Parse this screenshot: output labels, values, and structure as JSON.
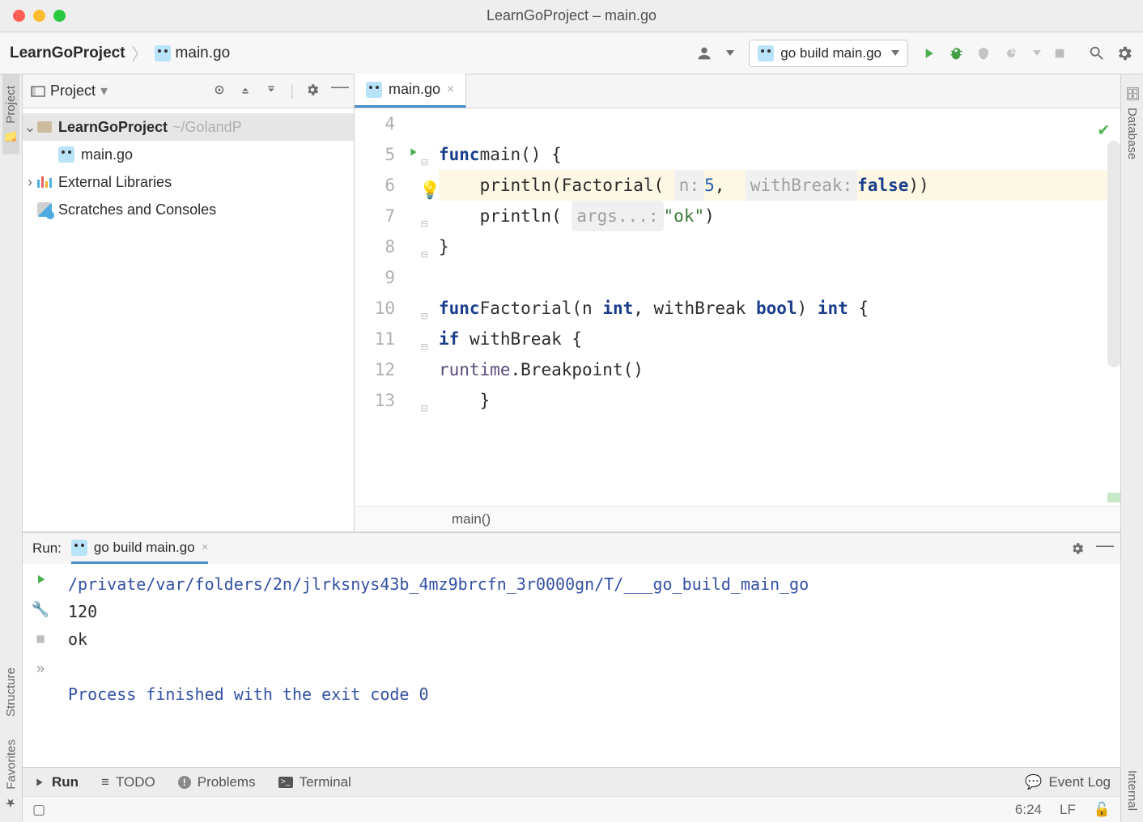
{
  "window": {
    "title": "LearnGoProject – main.go"
  },
  "breadcrumb": {
    "project": "LearnGoProject",
    "file": "main.go"
  },
  "runConfig": {
    "label": "go build main.go"
  },
  "leftGutter": {
    "project": "Project",
    "structure": "Structure",
    "favorites": "Favorites"
  },
  "rightGutter": {
    "database": "Database",
    "internal": "Internal"
  },
  "projectPanel": {
    "title": "Project",
    "tree": {
      "root": "LearnGoProject",
      "rootPath": "~/GolandP",
      "mainFile": "main.go",
      "external": "External Libraries",
      "scratches": "Scratches and Consoles"
    }
  },
  "editor": {
    "tab": "main.go",
    "breadcrumb": "main()",
    "lines": [
      {
        "n": 4,
        "html": ""
      },
      {
        "n": 5,
        "html": "<span class='kw'>func</span> <span class='fn'>main</span>() {"
      },
      {
        "n": 6,
        "html": "    println(Factorial( <span class='hint'>n:</span> <span class='num'>5</span>,  <span class='hint'>withBreak:</span> <span class='bool'>false</span>))",
        "hl": true
      },
      {
        "n": 7,
        "html": "    println( <span class='hint'>args...:</span> <span class='str'>\"ok\"</span>)"
      },
      {
        "n": 8,
        "html": "}"
      },
      {
        "n": 9,
        "html": ""
      },
      {
        "n": 10,
        "html": "<span class='kw'>func</span> <span class='fn'>Factorial</span>(n <span class='ty'>int</span>, withBreak <span class='ty'>bool</span>) <span class='ty'>int</span> {"
      },
      {
        "n": 11,
        "html": "    <span class='kw'>if</span> withBreak {"
      },
      {
        "n": 12,
        "html": "        <span class='pkg'>runtime</span>.Breakpoint()"
      },
      {
        "n": 13,
        "html": "    }"
      }
    ]
  },
  "run": {
    "label": "Run:",
    "tab": "go build main.go",
    "output": {
      "path": "/private/var/folders/2n/jlrksnys43b_4mz9brcfn_3r0000gn/T/___go_build_main_go",
      "line1": "120",
      "line2": "ok",
      "exit": "Process finished with the exit code 0"
    }
  },
  "bottomTabs": {
    "run": "Run",
    "todo": "TODO",
    "problems": "Problems",
    "terminal": "Terminal",
    "eventlog": "Event Log"
  },
  "status": {
    "pos": "6:24",
    "lf": "LF"
  }
}
